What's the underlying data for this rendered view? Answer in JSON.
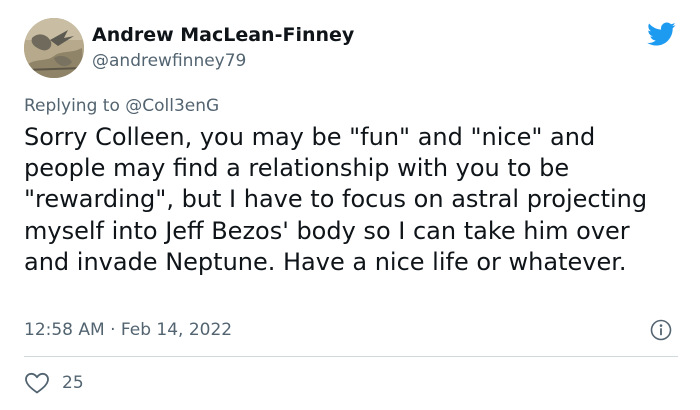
{
  "author": {
    "display_name": "Andrew MacLean-Finney",
    "handle": "@andrewfinney79"
  },
  "reply": {
    "prefix": "Replying to ",
    "mention": "@Coll3enG"
  },
  "tweet": {
    "text": "Sorry Colleen, you may be \"fun\" and \"nice\" and people may find a relationship with you to be \"rewarding\", but I have to focus on astral projecting myself into Jeff Bezos' body so I can take him over and invade Neptune. Have a nice life or whatever.",
    "timestamp": "12:58 AM · Feb 14, 2022"
  },
  "engagement": {
    "likes": "25"
  },
  "icons": {
    "brand": "twitter-bird-icon",
    "info": "info-icon",
    "like": "heart-icon"
  },
  "colors": {
    "brand": "#1d9bf0",
    "text_primary": "#0f1419",
    "text_secondary": "#536471",
    "divider": "#cfd9de"
  }
}
